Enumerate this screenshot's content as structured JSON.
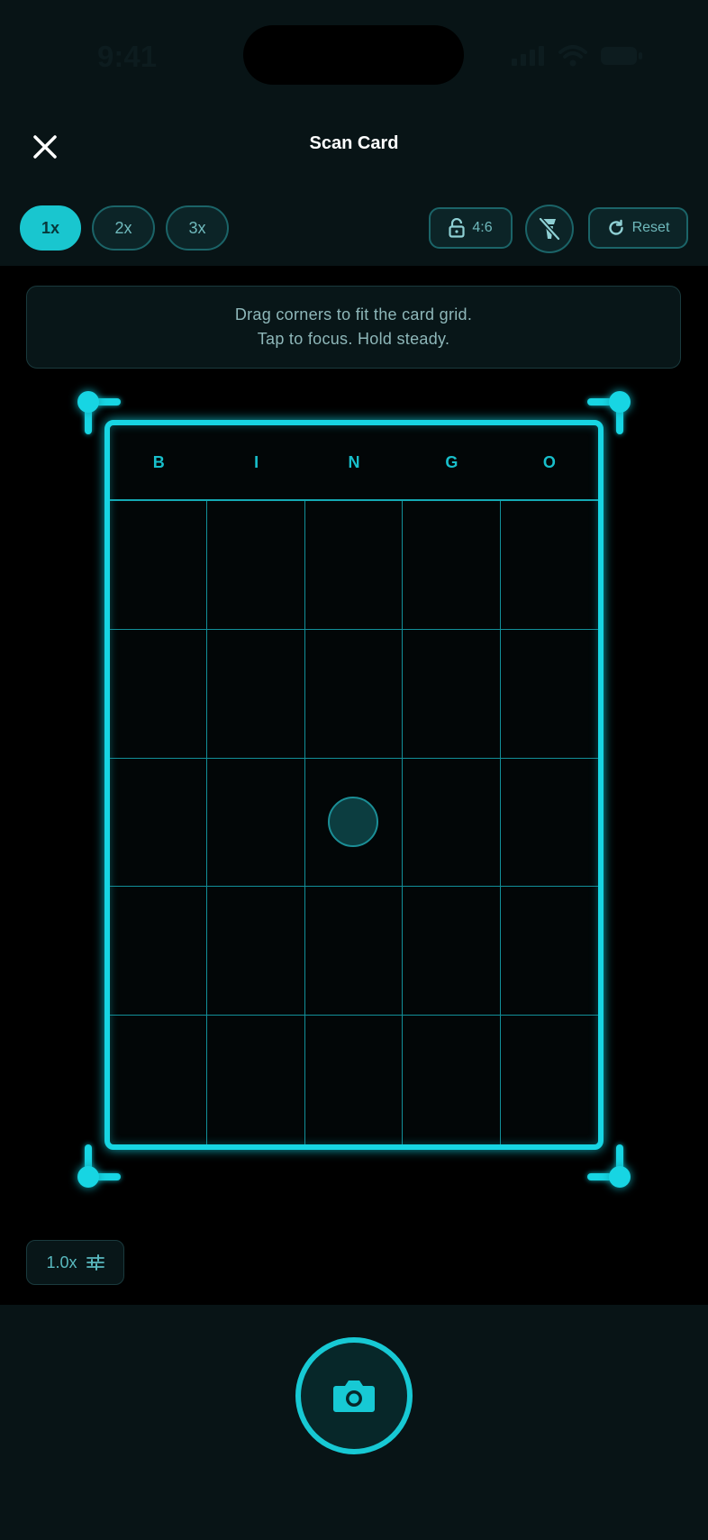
{
  "status_bar": {
    "time": "9:41"
  },
  "header": {
    "title": "Scan Card"
  },
  "zoom_levels": [
    {
      "label": "1x",
      "active": true
    },
    {
      "label": "2x",
      "active": false
    },
    {
      "label": "3x",
      "active": false
    }
  ],
  "toolbar": {
    "aspect_label": "4:6",
    "reset_label": "Reset"
  },
  "hint": {
    "line1": "Drag corners to fit the card grid.",
    "line2": "Tap to focus. Hold steady."
  },
  "card": {
    "letters": [
      "B",
      "I",
      "N",
      "G",
      "O"
    ],
    "rows": 5,
    "cols": 5,
    "free_space": {
      "row": 3,
      "col": 3
    }
  },
  "zoom_chip": {
    "label": "1.0x"
  },
  "colors": {
    "accent": "#17d5e3",
    "background": "#000000",
    "panel": "#081416"
  },
  "icons": [
    "close-icon",
    "lock-icon",
    "flash-off-icon",
    "reset-icon",
    "sliders-icon",
    "camera-icon"
  ]
}
